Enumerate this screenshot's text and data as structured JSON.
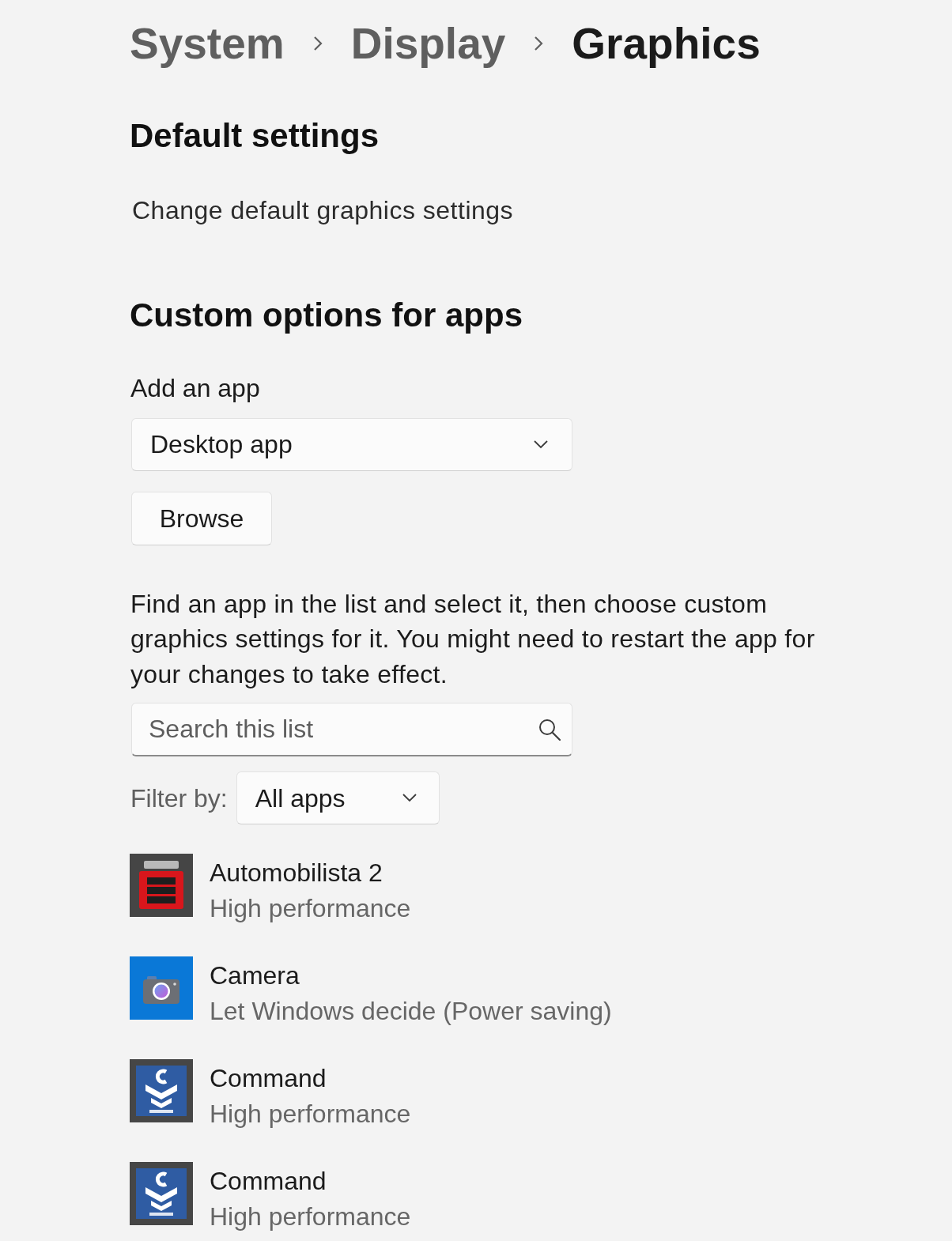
{
  "breadcrumb": [
    {
      "label": "System",
      "current": false
    },
    {
      "label": "Display",
      "current": false
    },
    {
      "label": "Graphics",
      "current": true
    }
  ],
  "default_settings": {
    "heading": "Default settings",
    "link": "Change default graphics settings"
  },
  "custom_options": {
    "heading": "Custom options for apps",
    "add_label": "Add an app",
    "app_type_dropdown": {
      "value": "Desktop app"
    },
    "browse_button": "Browse",
    "instructions": "Find an app in the list and select it, then choose custom graphics settings for it. You might need to restart the app for your changes to take effect.",
    "search": {
      "placeholder": "Search this list"
    },
    "filter": {
      "label": "Filter by:",
      "value": "All apps"
    }
  },
  "apps": [
    {
      "name": "Automobilista 2",
      "setting": "High performance",
      "kind": "racing"
    },
    {
      "name": "Camera",
      "setting": "Let Windows decide (Power saving)",
      "kind": "camera"
    },
    {
      "name": "Command",
      "setting": "High performance",
      "kind": "command"
    },
    {
      "name": "Command",
      "setting": "High performance",
      "kind": "command"
    }
  ]
}
